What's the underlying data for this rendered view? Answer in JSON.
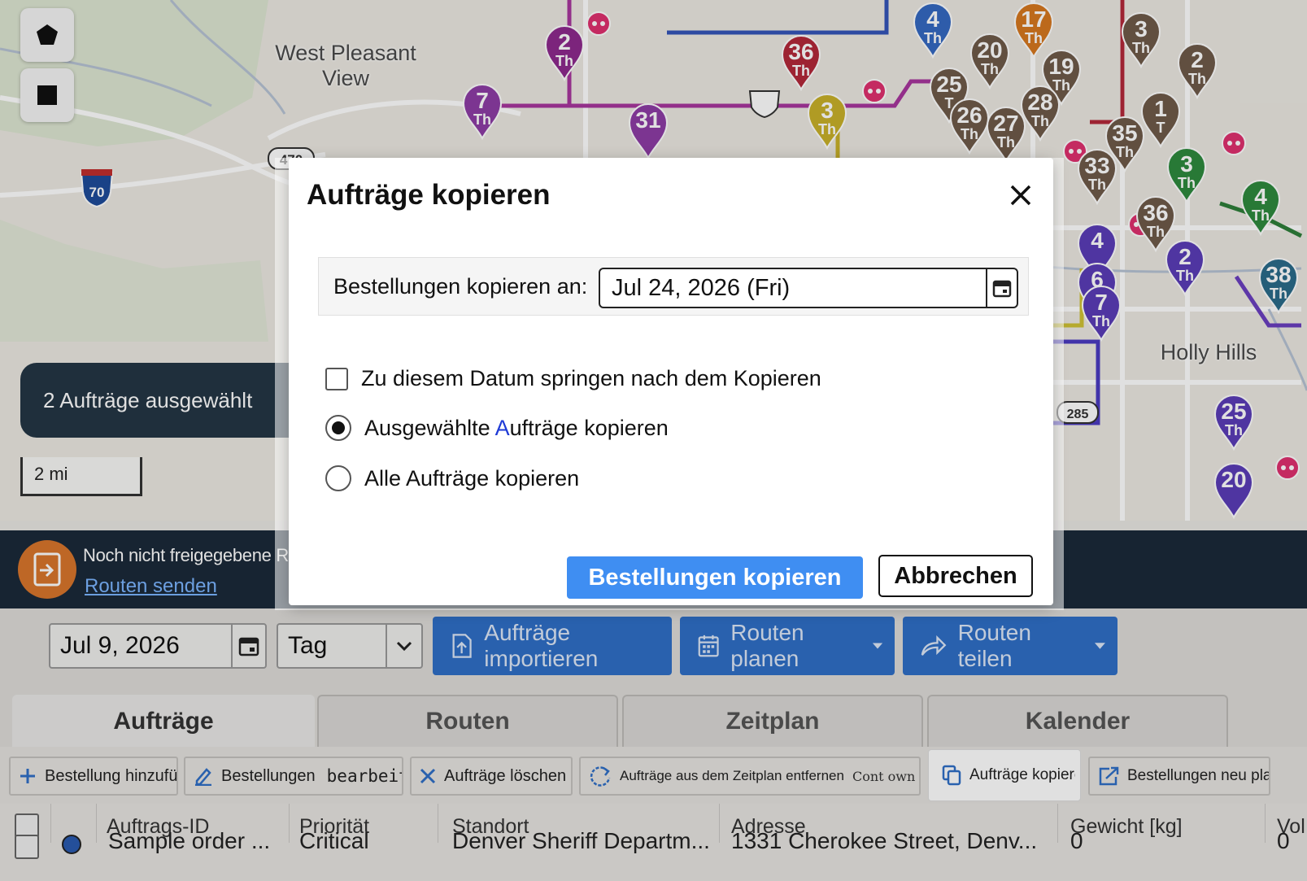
{
  "map": {
    "labels": [
      "West Pleasant View",
      "Holly Hills"
    ],
    "highway_shields": [
      "70",
      "470",
      "285"
    ],
    "selection_pill": "2 Aufträge ausgewählt",
    "scale": "2 mi",
    "markers": [
      {
        "num": "2",
        "sub": "Th",
        "color": "#8e2a8e"
      },
      {
        "num": "7",
        "sub": "Th",
        "color": "#8e3da6"
      },
      {
        "num": "31",
        "sub": "",
        "color": "#8e3da6"
      },
      {
        "num": "36",
        "sub": "Th",
        "color": "#b3283a"
      },
      {
        "num": "3",
        "sub": "Th",
        "color": "#c9b12a"
      },
      {
        "num": "4",
        "sub": "Th",
        "color": "#3569c2"
      },
      {
        "num": "20",
        "sub": "Th",
        "color": "#6f5a49"
      },
      {
        "num": "17",
        "sub": "Th",
        "color": "#d7781f"
      },
      {
        "num": "19",
        "sub": "Th",
        "color": "#6f5a49"
      },
      {
        "num": "3",
        "sub": "Th",
        "color": "#6f5a49"
      },
      {
        "num": "2",
        "sub": "Th",
        "color": "#6f5a49"
      },
      {
        "num": "25",
        "sub": "T",
        "color": "#6f5a49"
      },
      {
        "num": "26",
        "sub": "Th",
        "color": "#6f5a49"
      },
      {
        "num": "27",
        "sub": "Th",
        "color": "#6f5a49"
      },
      {
        "num": "28",
        "sub": "Th",
        "color": "#6f5a49"
      },
      {
        "num": "1",
        "sub": "T",
        "color": "#6f5a49"
      },
      {
        "num": "35",
        "sub": "Th",
        "color": "#6f5a49"
      },
      {
        "num": "33",
        "sub": "Th",
        "color": "#6f5a49"
      },
      {
        "num": "3",
        "sub": "Th",
        "color": "#2e8a3e"
      },
      {
        "num": "36",
        "sub": "Th",
        "color": "#6f5a49"
      },
      {
        "num": "4",
        "sub": "Th",
        "color": "#2e8a3e"
      },
      {
        "num": "4",
        "sub": "",
        "color": "#5b3db8"
      },
      {
        "num": "6",
        "sub": "",
        "color": "#5b3db8"
      },
      {
        "num": "7",
        "sub": "Th",
        "color": "#5b3db8"
      },
      {
        "num": "2",
        "sub": "Th",
        "color": "#5b3db8"
      },
      {
        "num": "38",
        "sub": "Th",
        "color": "#2b6c8a"
      },
      {
        "num": "25",
        "sub": "Th",
        "color": "#5b3db8"
      },
      {
        "num": "20",
        "sub": "",
        "color": "#5b3db8"
      }
    ]
  },
  "banner": {
    "title": "Noch nicht freigegebene Routen",
    "link": "Routen senden"
  },
  "toolbar": {
    "date": "Jul 9, 2026",
    "view": "Tag",
    "import": "Aufträge importieren",
    "plan": "Routen planen",
    "share": "Routen teilen"
  },
  "tabs": [
    "Aufträge",
    "Routen",
    "Zeitplan",
    "Kalender"
  ],
  "actions": {
    "add": "Bestellung hinzufügen",
    "edit_a": "Bestellungen",
    "edit_b": "bearbeiten",
    "delete": "Aufträge löschen",
    "unschedule": "Aufträge aus dem Zeitplan entfernen",
    "unschedule_extra": "Cont own recu",
    "copy": "Aufträge kopieren",
    "replan": "Bestellungen neu planen"
  },
  "table": {
    "headers": [
      "Auftrags-ID",
      "Priorität",
      "Standort",
      "Adresse",
      "Gewicht [kg]",
      "Vol"
    ],
    "row": [
      "Sample order ...",
      "Critical",
      "Denver Sheriff Departm...",
      "1331 Cherokee Street, Denv...",
      "0",
      "0"
    ]
  },
  "modal": {
    "title": "Aufträge kopieren",
    "date_label": "Bestellungen kopieren an:",
    "date_value": "Jul 24, 2026 (Fri)",
    "opt_jump": "Zu diesem Datum springen nach dem Kopieren",
    "opt_selected_pre": "Ausgewählte ",
    "opt_selected_accent": "A",
    "opt_selected_post": "ufträge kopieren",
    "opt_all": "Alle Aufträge kopieren",
    "btn_copy": "Bestellungen kopieren",
    "btn_cancel": "Abbrechen"
  }
}
